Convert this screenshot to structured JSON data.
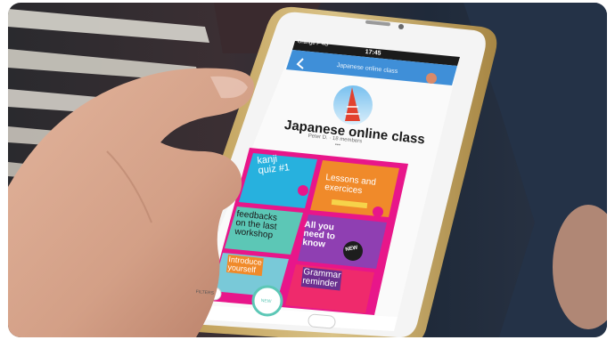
{
  "status_bar": {
    "carrier": "Orange F 4G",
    "time": "17:45"
  },
  "app_header": {
    "title": "Japanese online class"
  },
  "group": {
    "title": "Japanese online class",
    "meta": "Peter D. · 18 members",
    "more": "•••"
  },
  "tiles": [
    {
      "label": "kanji\nquiz #1"
    },
    {
      "label": "Lessons and\nexercices"
    },
    {
      "label": "feedbacks\non the last\nworkshop"
    },
    {
      "label": "All you\nneed to\nknow"
    },
    {
      "label": "Introduce\nyourself"
    },
    {
      "label": "Grammar\nreminder"
    }
  ],
  "badges": {
    "new": "NEW"
  },
  "bottom_bar": {
    "filters": "FILTERS",
    "new_post": "NEW"
  },
  "colors": {
    "brand_pink": "#e8168a",
    "tile_cyan": "#27b1de",
    "tile_orange": "#f08a2a",
    "header_blue": "#3f8fd8"
  }
}
